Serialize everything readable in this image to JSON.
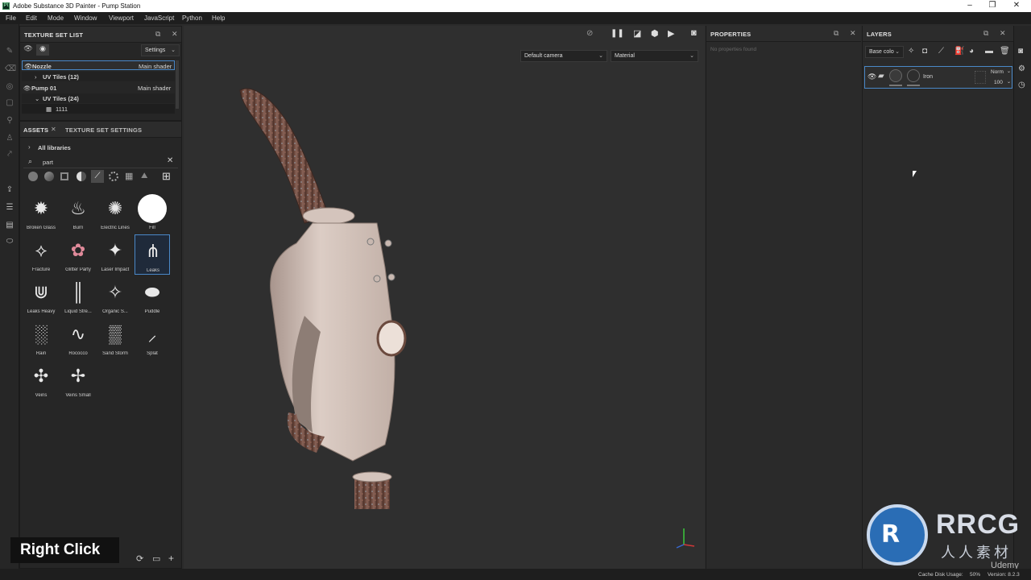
{
  "window": {
    "title": "Adobe Substance 3D Painter - Pump Station",
    "app_icon": "Pt"
  },
  "menu": [
    "File",
    "Edit",
    "Mode",
    "Window",
    "Viewport",
    "JavaScript",
    "Python",
    "Help"
  ],
  "texture_set_list": {
    "title": "TEXTURE SET LIST",
    "settings_label": "Settings",
    "sets": [
      {
        "name": "Nozzle",
        "shader": "Main shader"
      },
      {
        "name": "Pump 01",
        "shader": "Main shader"
      }
    ],
    "uv_tiles_nozzle": "UV Tiles (12)",
    "uv_tiles_pump": "UV Tiles (24)",
    "tile_1111": "1111"
  },
  "assets": {
    "tab_assets": "ASSETS",
    "tab_tss": "TEXTURE SET SETTINGS",
    "all_libraries": "All libraries",
    "search_value": "part",
    "items": [
      "Broken Glass",
      "Burn",
      "Electric Lines",
      "Fill",
      "Fracture",
      "Glitter Party",
      "Laser Impact",
      "Leaks",
      "Leaks Heavy",
      "Liquid Stre...",
      "Organic S...",
      "Puddle",
      "Rain",
      "Rococco",
      "Sand Storm",
      "Splat",
      "Veins",
      "Veins Small"
    ],
    "selected": "Leaks"
  },
  "viewport": {
    "camera": "Default camera",
    "mode": "Material",
    "caption": "Right Click"
  },
  "properties": {
    "title": "PROPERTIES",
    "empty": "No properties found"
  },
  "layers": {
    "title": "LAYERS",
    "channel": "Base colo",
    "layer_name": "Iron",
    "blend": "Norm",
    "opacity": "100"
  },
  "status": {
    "cache": "Cache Disk Usage:",
    "cache_value": "50%",
    "version_label": "Version: 8.2.3"
  },
  "watermark": {
    "brand": "RRCG",
    "sub": "人人素材",
    "udemy": "Udemy"
  },
  "colors": {
    "accent": "#4a88c8",
    "brand_blue": "#2a6db5",
    "nozzle_body": "#d8c8c0"
  }
}
